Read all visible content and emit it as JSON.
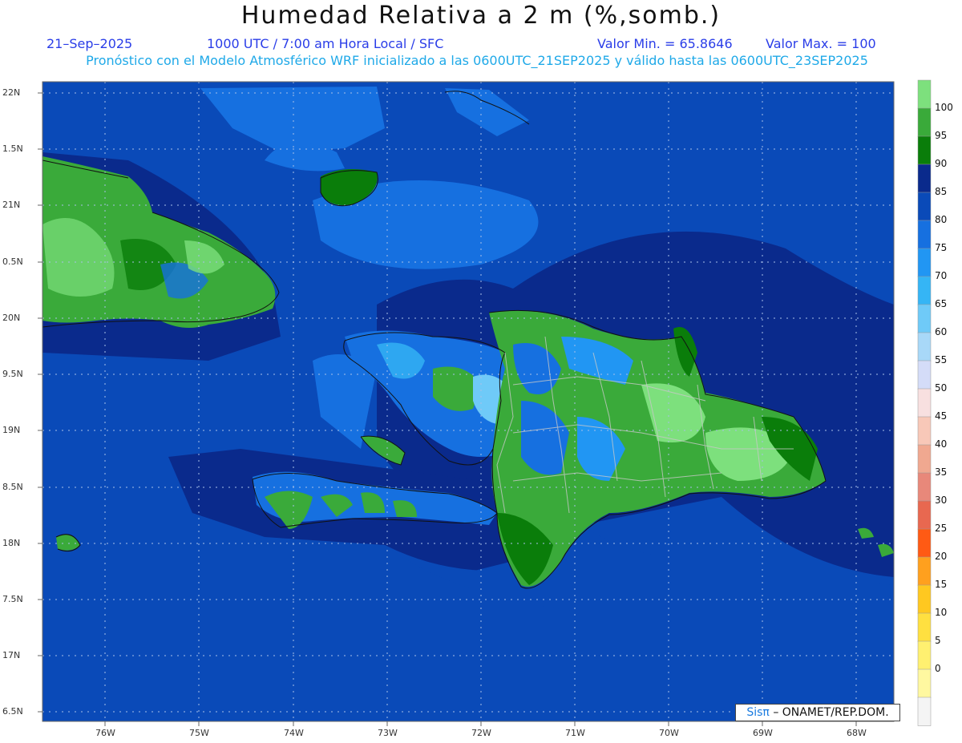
{
  "header": {
    "title": "Humedad Relativa a 2 m (%,somb.)",
    "date": "21–Sep–2025",
    "time": "1000 UTC / 7:00 am Hora Local / SFC",
    "min": "Valor Min. = 65.8646",
    "max": "Valor Max. = 100",
    "forecast": "Pronóstico con el Modelo Atmosférico WRF inicializado a las 0600UTC_21SEP2025 y válido hasta las  0600UTC_23SEP2025"
  },
  "lat_labels": [
    "22N",
    "1.5N",
    "21N",
    "0.5N",
    "20N",
    "9.5N",
    "19N",
    "8.5N",
    "18N",
    "7.5N",
    "17N",
    "6.5N"
  ],
  "lon_labels": [
    "76W",
    "75W",
    "74W",
    "73W",
    "72W",
    "71W",
    "70W",
    "69W",
    "68W"
  ],
  "colorbar": {
    "labels": [
      "100",
      "95",
      "90",
      "85",
      "80",
      "75",
      "70",
      "65",
      "60",
      "55",
      "50",
      "45",
      "40",
      "35",
      "30",
      "25",
      "20",
      "15",
      "10",
      "5",
      "0"
    ],
    "colors": [
      "#7de07d",
      "#3aaa3a",
      "#0a7d0a",
      "#0a2a8c",
      "#0a4ab8",
      "#1670e0",
      "#2196f3",
      "#35b5f5",
      "#6fcaf8",
      "#a8d8f8",
      "#d4dcf8",
      "#f8e0e0",
      "#f8c8b8",
      "#f0a890",
      "#e8887a",
      "#e86850",
      "#ff5a14",
      "#ffa01e",
      "#ffc820",
      "#ffe040",
      "#fff070",
      "#fff8a0",
      "#f4f4f4"
    ]
  },
  "credit": {
    "sis": "Sisπ",
    "org": "– ONAMET/REP.DOM."
  }
}
